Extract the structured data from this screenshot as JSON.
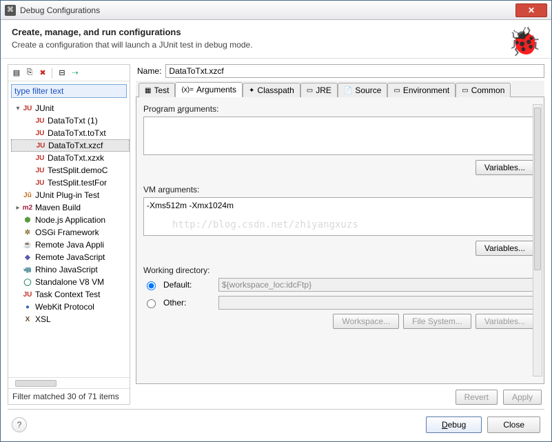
{
  "window": {
    "title": "Debug Configurations"
  },
  "header": {
    "title": "Create, manage, and run configurations",
    "subtitle": "Create a configuration that will launch a JUnit test in debug mode."
  },
  "left": {
    "filter_placeholder": "type filter text",
    "tree": [
      {
        "depth": 0,
        "arrow": "▾",
        "iconClass": "ju",
        "icon": "JU",
        "label": "JUnit"
      },
      {
        "depth": 1,
        "arrow": "",
        "iconClass": "ju",
        "icon": "JU",
        "label": "DataToTxt (1)"
      },
      {
        "depth": 1,
        "arrow": "",
        "iconClass": "ju",
        "icon": "JU",
        "label": "DataToTxt.toTxt"
      },
      {
        "depth": 1,
        "arrow": "",
        "iconClass": "ju",
        "icon": "JU",
        "label": "DataToTxt.xzcf",
        "selected": true
      },
      {
        "depth": 1,
        "arrow": "",
        "iconClass": "ju",
        "icon": "JU",
        "label": "DataToTxt.xzxk"
      },
      {
        "depth": 1,
        "arrow": "",
        "iconClass": "ju",
        "icon": "JU",
        "label": "TestSplit.demoC"
      },
      {
        "depth": 1,
        "arrow": "",
        "iconClass": "ju",
        "icon": "JU",
        "label": "TestSplit.testFor"
      },
      {
        "depth": 0,
        "arrow": "",
        "iconClass": "jup",
        "icon": "Jû",
        "label": "JUnit Plug-in Test"
      },
      {
        "depth": 0,
        "arrow": "▸",
        "iconClass": "m2",
        "icon": "m2",
        "label": "Maven Build"
      },
      {
        "depth": 0,
        "arrow": "",
        "iconClass": "node",
        "icon": "⬢",
        "label": "Node.js Application"
      },
      {
        "depth": 0,
        "arrow": "",
        "iconClass": "osgi",
        "icon": "✲",
        "label": "OSGi Framework"
      },
      {
        "depth": 0,
        "arrow": "",
        "iconClass": "java",
        "icon": "☕",
        "label": "Remote Java Appli"
      },
      {
        "depth": 0,
        "arrow": "",
        "iconClass": "js",
        "icon": "◆",
        "label": "Remote JavaScript"
      },
      {
        "depth": 0,
        "arrow": "",
        "iconClass": "rh",
        "icon": "🦏",
        "label": "Rhino JavaScript"
      },
      {
        "depth": 0,
        "arrow": "",
        "iconClass": "v8",
        "icon": "◯",
        "label": "Standalone V8 VM"
      },
      {
        "depth": 0,
        "arrow": "",
        "iconClass": "task",
        "icon": "JU",
        "label": "Task Context Test"
      },
      {
        "depth": 0,
        "arrow": "",
        "iconClass": "wk",
        "icon": "●",
        "label": "WebKit Protocol"
      },
      {
        "depth": 0,
        "arrow": "",
        "iconClass": "xsl",
        "icon": "X",
        "label": "XSL"
      }
    ],
    "filter_status": "Filter matched 30 of 71 items"
  },
  "right": {
    "name_label": "Name:",
    "name_value": "DataToTxt.xzcf",
    "tabs": [
      "Test",
      "Arguments",
      "Classpath",
      "JRE",
      "Source",
      "Environment",
      "Common"
    ],
    "active_tab": 1,
    "program_args_label": "Program arguments:",
    "program_args_value": "",
    "vm_args_label": "VM arguments:",
    "vm_args_value": "-Xms512m -Xmx1024m",
    "variables_label": "Variables...",
    "working_dir_label": "Working directory:",
    "default_label": "Default:",
    "other_label": "Other:",
    "default_value": "${workspace_loc:idcFtp}",
    "workspace_btn": "Workspace...",
    "filesystem_btn": "File System...",
    "revert_btn": "Revert",
    "apply_btn": "Apply"
  },
  "footer": {
    "debug": "Debug",
    "close": "Close"
  },
  "watermark": "http://blog.csdn.net/zhiyangxuzs"
}
